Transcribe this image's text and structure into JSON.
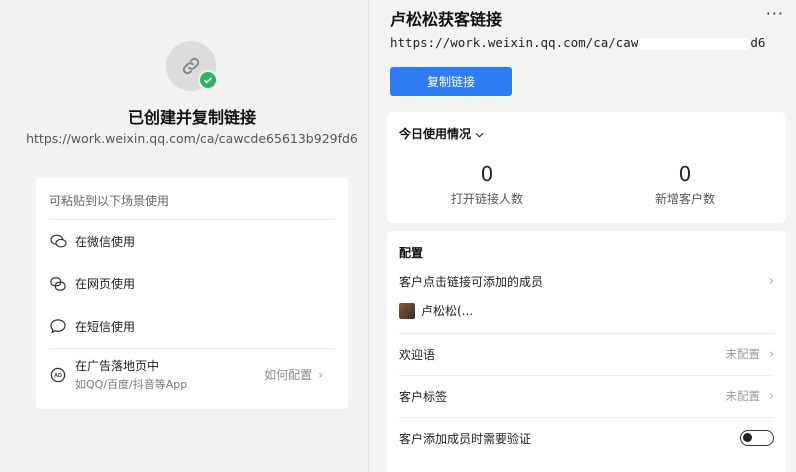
{
  "left": {
    "created_title": "已创建并复制链接",
    "created_url": "https://work.weixin.qq.com/ca/cawcde65613b929fd6",
    "scene_heading": "可粘贴到以下场景使用",
    "scenes": [
      {
        "label": "在微信使用",
        "icon": "wechat-icon"
      },
      {
        "label": "在网页使用",
        "icon": "web-icon"
      },
      {
        "label": "在短信使用",
        "icon": "sms-icon"
      },
      {
        "label": "在广告落地页中",
        "sub": "如QQ/百度/抖音等App",
        "icon": "ad-icon",
        "action": "如何配置"
      }
    ]
  },
  "right": {
    "title": "卢松松获客链接",
    "url_prefix": "https://work.weixin.qq.com/ca/caw",
    "url_suffix": "d6",
    "copy_button": "复制链接",
    "today": {
      "heading": "今日使用情况",
      "stats": [
        {
          "value": "0",
          "label": "打开链接人数"
        },
        {
          "value": "0",
          "label": "新增客户数"
        }
      ]
    },
    "config": {
      "heading": "配置",
      "members_label": "客户点击链接可添加的成员",
      "member_name": "卢松松(...",
      "greeting_label": "欢迎语",
      "greeting_value": "未配置",
      "tags_label": "客户标签",
      "tags_value": "未配置",
      "verify_label": "客户添加成员时需要验证",
      "verify_enabled": false
    }
  },
  "colors": {
    "accent": "#2f7df6",
    "success": "#2bb55c"
  }
}
